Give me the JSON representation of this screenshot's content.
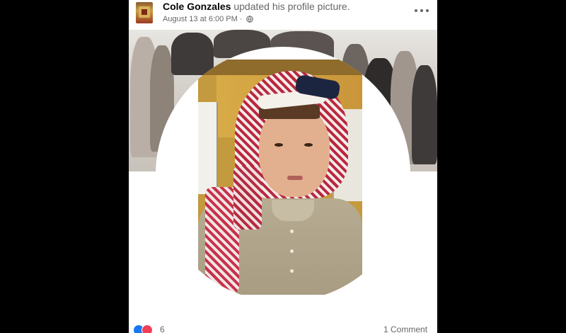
{
  "post": {
    "author": "Cole Gonzales",
    "action": "updated his profile picture.",
    "timestamp": "August 13 at 6:00 PM",
    "separator": "·",
    "privacy_icon": "globe-icon",
    "more_icon": "more-options-icon",
    "reaction_icons": [
      "like-icon",
      "love-icon"
    ],
    "reaction_count": "6",
    "comment_count": "1 Comment"
  },
  "colors": {
    "like": "#1877f2",
    "love": "#f33e58",
    "secondary_text": "#65676b",
    "primary_text": "#050505"
  }
}
